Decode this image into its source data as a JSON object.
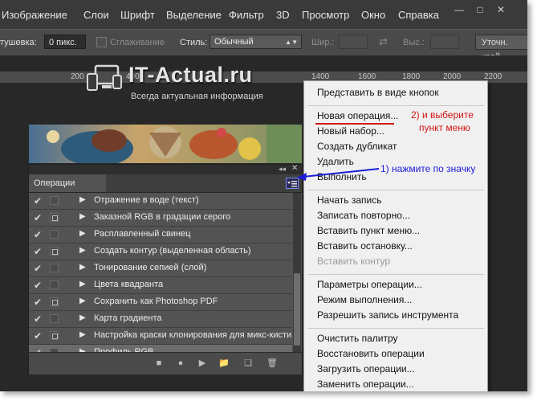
{
  "menubar": {
    "items": [
      "Изображение",
      "Слои",
      "Шрифт",
      "Выделение",
      "Фильтр",
      "3D",
      "Просмотр",
      "Окно",
      "Справка"
    ]
  },
  "options": {
    "feather_label": "тушевка:",
    "feather_value": "0 пикс.",
    "smoothing_label": "Сглаживание",
    "style_label": "Стиль:",
    "style_value": "Обычный",
    "width_label": "Шир.:",
    "height_label": "Выс.:",
    "refine_button": "Уточн. край"
  },
  "ruler": {
    "labels": [
      "200",
      "400",
      "1400",
      "1600",
      "1800",
      "2000",
      "2200"
    ]
  },
  "watermark": {
    "title": "IT-Actual.ru",
    "subtitle": "Всегда актуальная информация"
  },
  "panel": {
    "tab_label": "Операции",
    "rows": [
      {
        "name": "Отражение в воде (текст)",
        "dialog": false,
        "selected": false
      },
      {
        "name": "Заказной RGB в градации серого",
        "dialog": true,
        "selected": false
      },
      {
        "name": "Расплавленный свинец",
        "dialog": false,
        "selected": false
      },
      {
        "name": "Создать контур (выделенная область)",
        "dialog": true,
        "selected": false
      },
      {
        "name": "Тонирование сепией (слой)",
        "dialog": false,
        "selected": false
      },
      {
        "name": "Цвета квадранта",
        "dialog": false,
        "selected": false
      },
      {
        "name": "Сохранить как Photoshop PDF",
        "dialog": true,
        "selected": false
      },
      {
        "name": "Карта градиента",
        "dialog": false,
        "selected": false
      },
      {
        "name": "Настройка краски клонирования для микс-кисти",
        "dialog": true,
        "selected": false
      },
      {
        "name": "Профиль RGB",
        "dialog": false,
        "selected": true
      }
    ]
  },
  "flyout": {
    "items": [
      {
        "label": "Представить в виде кнопок",
        "disabled": false
      },
      {
        "sep": true
      },
      {
        "label": "Новая операция...",
        "disabled": false
      },
      {
        "label": "Новый набор...",
        "disabled": false
      },
      {
        "label": "Создать дубликат",
        "disabled": false
      },
      {
        "label": "Удалить",
        "disabled": false
      },
      {
        "label": "Выполнить",
        "disabled": false
      },
      {
        "sep": true
      },
      {
        "label": "Начать запись",
        "disabled": false
      },
      {
        "label": "Записать повторно...",
        "disabled": false
      },
      {
        "label": "Вставить пункт меню...",
        "disabled": false
      },
      {
        "label": "Вставить остановку...",
        "disabled": false
      },
      {
        "label": "Вставить контур",
        "disabled": true
      },
      {
        "sep": true
      },
      {
        "label": "Параметры операции...",
        "disabled": false
      },
      {
        "label": "Режим выполнения...",
        "disabled": false
      },
      {
        "label": "Разрешить запись инструмента",
        "disabled": false
      },
      {
        "sep": true
      },
      {
        "label": "Очистить палитру",
        "disabled": false
      },
      {
        "label": "Восстановить операции",
        "disabled": false
      },
      {
        "label": "Загрузить операции...",
        "disabled": false
      },
      {
        "label": "Заменить операции...",
        "disabled": false
      }
    ]
  },
  "annotations": {
    "step1": "1) нажмите по значку",
    "step2_line1": "2) и выберите",
    "step2_line2": "пункт меню"
  },
  "colors": {
    "annotation_blue": "#1b1bd8",
    "annotation_red": "#d21414",
    "panel_bg": "#535353",
    "menu_bg": "#f0f0f0"
  }
}
